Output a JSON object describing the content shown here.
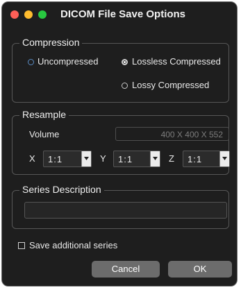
{
  "window": {
    "title": "DICOM File Save Options"
  },
  "compression": {
    "title": "Compression",
    "options": [
      "Uncompressed",
      "Lossless Compressed",
      "Lossy Compressed"
    ],
    "selected": "Lossless Compressed"
  },
  "resample": {
    "title": "Resample",
    "volume_label": "Volume",
    "volume_value": "400 X 400 X 552",
    "x_label": "X",
    "x_value": "1:1",
    "y_label": "Y",
    "y_value": "1:1",
    "z_label": "Z",
    "z_value": "1:1"
  },
  "series": {
    "title": "Series Description",
    "value": ""
  },
  "save_additional": {
    "label": "Save additional series",
    "checked": false
  },
  "buttons": {
    "cancel": "Cancel",
    "ok": "OK"
  }
}
